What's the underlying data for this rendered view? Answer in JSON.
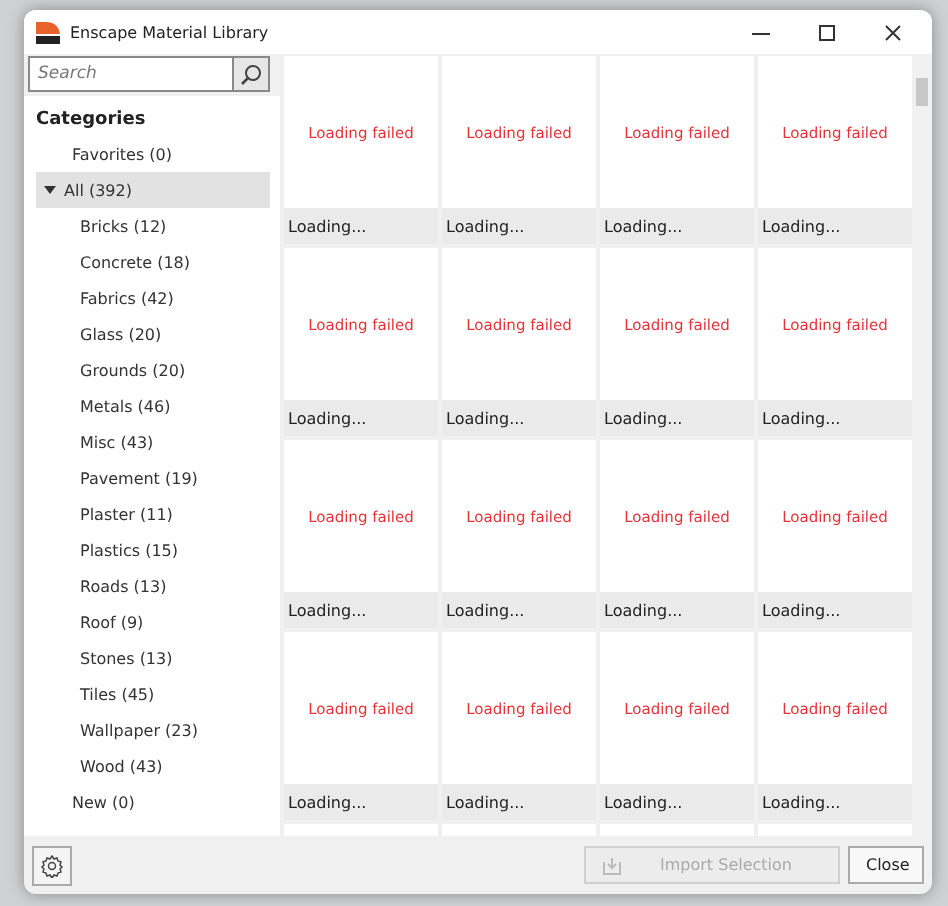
{
  "window": {
    "title": "Enscape Material Library"
  },
  "search": {
    "placeholder": "Search"
  },
  "sidebar": {
    "heading": "Categories",
    "items": [
      {
        "label": "Favorites (0)",
        "selected": false
      },
      {
        "label": "All (392)",
        "selected": true,
        "expanded": true,
        "children": [
          {
            "label": "Bricks (12)",
            "selected": false
          },
          {
            "label": "Concrete (18)",
            "selected": false
          },
          {
            "label": "Fabrics (42)",
            "selected": false
          },
          {
            "label": "Glass (20)",
            "selected": false
          },
          {
            "label": "Grounds (20)",
            "selected": false
          },
          {
            "label": "Metals (46)",
            "selected": false
          },
          {
            "label": "Misc (43)",
            "selected": false
          },
          {
            "label": "Pavement (19)",
            "selected": false
          },
          {
            "label": "Plaster (11)",
            "selected": false
          },
          {
            "label": "Plastics (15)",
            "selected": false
          },
          {
            "label": "Roads (13)",
            "selected": false
          },
          {
            "label": "Roof (9)",
            "selected": false
          },
          {
            "label": "Stones (13)",
            "selected": false
          },
          {
            "label": "Tiles (45)",
            "selected": false
          },
          {
            "label": "Wallpaper (23)",
            "selected": false
          },
          {
            "label": "Wood (43)",
            "selected": false
          }
        ]
      },
      {
        "label": "New (0)",
        "selected": false
      }
    ]
  },
  "tiles": [
    {
      "status": "Loading failed",
      "caption": "Loading..."
    },
    {
      "status": "Loading failed",
      "caption": "Loading..."
    },
    {
      "status": "Loading failed",
      "caption": "Loading..."
    },
    {
      "status": "Loading failed",
      "caption": "Loading..."
    },
    {
      "status": "Loading failed",
      "caption": "Loading..."
    },
    {
      "status": "Loading failed",
      "caption": "Loading..."
    },
    {
      "status": "Loading failed",
      "caption": "Loading..."
    },
    {
      "status": "Loading failed",
      "caption": "Loading..."
    },
    {
      "status": "Loading failed",
      "caption": "Loading..."
    },
    {
      "status": "Loading failed",
      "caption": "Loading..."
    },
    {
      "status": "Loading failed",
      "caption": "Loading..."
    },
    {
      "status": "Loading failed",
      "caption": "Loading..."
    },
    {
      "status": "Loading failed",
      "caption": "Loading..."
    },
    {
      "status": "Loading failed",
      "caption": "Loading..."
    },
    {
      "status": "Loading failed",
      "caption": "Loading..."
    },
    {
      "status": "Loading failed",
      "caption": "Loading..."
    }
  ],
  "buttons": [
    {
      "label": "Import Selection",
      "disabled": true
    },
    {
      "label": "Close",
      "disabled": false
    }
  ]
}
